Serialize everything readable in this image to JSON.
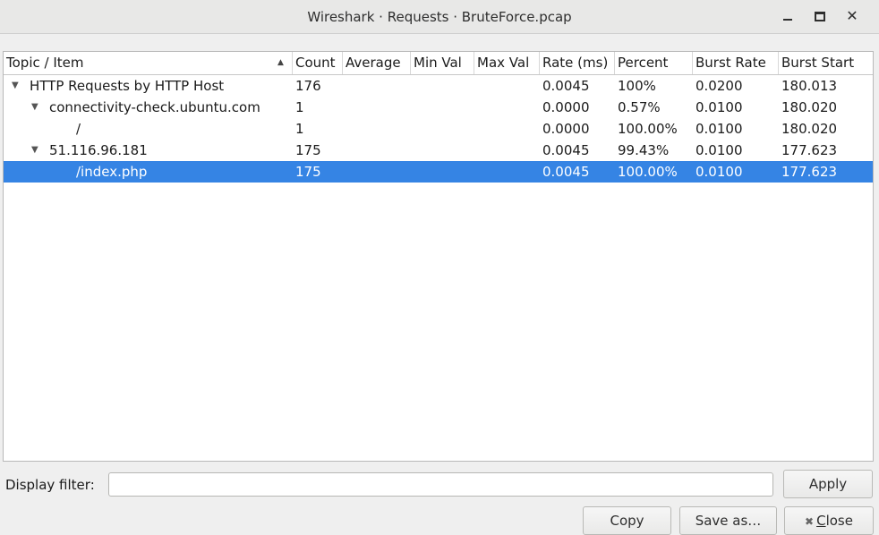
{
  "window": {
    "title": "Wireshark · Requests · BruteForce.pcap"
  },
  "table": {
    "columns": [
      {
        "label": "Topic / Item"
      },
      {
        "label": "Count"
      },
      {
        "label": "Average"
      },
      {
        "label": "Min Val"
      },
      {
        "label": "Max Val"
      },
      {
        "label": "Rate (ms)"
      },
      {
        "label": "Percent"
      },
      {
        "label": "Burst Rate"
      },
      {
        "label": "Burst Start"
      }
    ],
    "sort_column": "Topic / Item",
    "sort_direction": "ascending",
    "rows": [
      {
        "level": 0,
        "expanded": true,
        "selected": false,
        "topic": "HTTP Requests by HTTP Host",
        "count": "176",
        "average": "",
        "min": "",
        "max": "",
        "rate": "0.0045",
        "percent": "100%",
        "burst_rate": "0.0200",
        "burst_start": "180.013"
      },
      {
        "level": 1,
        "expanded": true,
        "selected": false,
        "topic": "connectivity-check.ubuntu.com",
        "count": "1",
        "average": "",
        "min": "",
        "max": "",
        "rate": "0.0000",
        "percent": "0.57%",
        "burst_rate": "0.0100",
        "burst_start": "180.020"
      },
      {
        "level": 2,
        "expanded": false,
        "selected": false,
        "topic": "/",
        "count": "1",
        "average": "",
        "min": "",
        "max": "",
        "rate": "0.0000",
        "percent": "100.00%",
        "burst_rate": "0.0100",
        "burst_start": "180.020"
      },
      {
        "level": 1,
        "expanded": true,
        "selected": false,
        "topic": "51.116.96.181",
        "count": "175",
        "average": "",
        "min": "",
        "max": "",
        "rate": "0.0045",
        "percent": "99.43%",
        "burst_rate": "0.0100",
        "burst_start": "177.623"
      },
      {
        "level": 2,
        "expanded": false,
        "selected": true,
        "topic": "/index.php",
        "count": "175",
        "average": "",
        "min": "",
        "max": "",
        "rate": "0.0045",
        "percent": "100.00%",
        "burst_rate": "0.0100",
        "burst_start": "177.623"
      }
    ]
  },
  "filter": {
    "label": "Display filter:",
    "value": "",
    "apply_label": "Apply"
  },
  "buttons": {
    "copy_label": "Copy",
    "save_label": "Save as…",
    "close_label_prefix": "",
    "close_label_mnemonic": "C",
    "close_label_rest": "lose"
  },
  "colors": {
    "selection": "#3584e4",
    "background": "#efefef"
  },
  "icons": {
    "expander": "triangle-down-icon",
    "sort": "sort-ascending-icon",
    "close_button": "close-x-icon"
  }
}
